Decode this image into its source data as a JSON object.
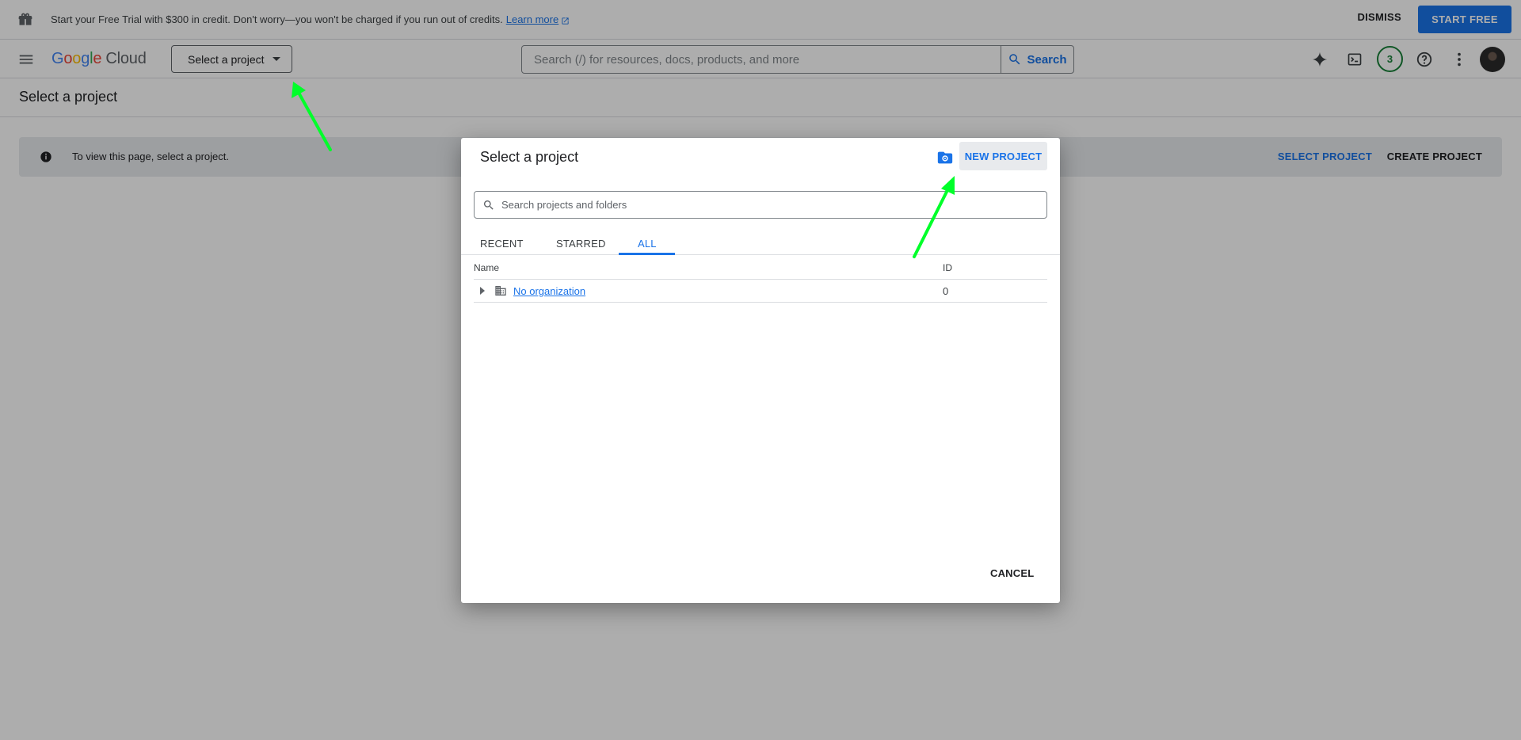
{
  "banner": {
    "text": "Start your Free Trial with $300 in credit. Don't worry—you won't be charged if you run out of credits.",
    "learn_more": "Learn more",
    "dismiss": "DISMISS",
    "start_free": "START FREE"
  },
  "header": {
    "logo_letters": [
      "G",
      "o",
      "o",
      "g",
      "l",
      "e"
    ],
    "logo_product": "Cloud",
    "project_picker": "Select a project",
    "search_placeholder": "Search (/) for resources, docs, products, and more",
    "search_button": "Search",
    "notifications_count": "3"
  },
  "page": {
    "title": "Select a project",
    "info_text": "To view this page, select a project.",
    "select_project": "SELECT PROJECT",
    "create_project": "CREATE PROJECT"
  },
  "dialog": {
    "title": "Select a project",
    "new_project": "NEW PROJECT",
    "search_placeholder": "Search projects and folders",
    "tabs": [
      {
        "label": "RECENT",
        "active": false
      },
      {
        "label": "STARRED",
        "active": false
      },
      {
        "label": "ALL",
        "active": true
      }
    ],
    "columns": {
      "name": "Name",
      "id": "ID"
    },
    "rows": [
      {
        "name": "No organization",
        "id": "0"
      }
    ],
    "cancel": "CANCEL"
  },
  "colors": {
    "accent": "#1a73e8",
    "annotation_arrow": "#00ff2a"
  }
}
